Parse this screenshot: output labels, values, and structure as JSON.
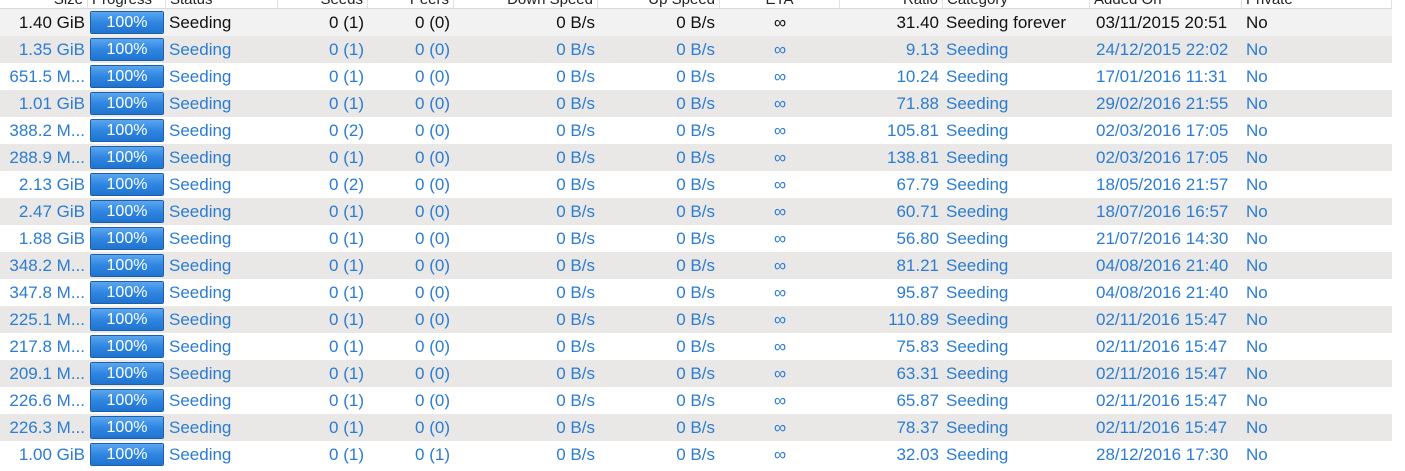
{
  "columns": {
    "size": "Size",
    "progress": "Progress",
    "status": "Status",
    "seeds": "Seeds",
    "peers": "Peers",
    "down_speed": "Down Speed",
    "up_speed": "Up Speed",
    "eta": "ETA",
    "ratio": "Ratio",
    "category": "Category",
    "added_on": "Added On",
    "private": "Private"
  },
  "colors": {
    "link_blue": "#2b7cd3",
    "selected_text": "#111111",
    "alt_row": "#eae8e6",
    "progress_blue": "#2f86e0"
  },
  "rows": [
    {
      "size": "1.40 GiB",
      "progress_label": "100%",
      "progress": 1.0,
      "status": "Seeding",
      "seeds": "0 (1)",
      "peers": "0 (0)",
      "down_speed": "0 B/s",
      "up_speed": "0 B/s",
      "eta": "∞",
      "ratio": "31.40",
      "category": "Seeding forever",
      "added_on": "03/11/2015 20:51",
      "private": "No",
      "selected": true
    },
    {
      "size": "1.35 GiB",
      "progress_label": "100%",
      "progress": 1.0,
      "status": "Seeding",
      "seeds": "0 (1)",
      "peers": "0 (0)",
      "down_speed": "0 B/s",
      "up_speed": "0 B/s",
      "eta": "∞",
      "ratio": "9.13",
      "category": "Seeding",
      "added_on": "24/12/2015 22:02",
      "private": "No"
    },
    {
      "size": "651.5 M...",
      "progress_label": "100%",
      "progress": 1.0,
      "status": "Seeding",
      "seeds": "0 (1)",
      "peers": "0 (0)",
      "down_speed": "0 B/s",
      "up_speed": "0 B/s",
      "eta": "∞",
      "ratio": "10.24",
      "category": "Seeding",
      "added_on": "17/01/2016 11:31",
      "private": "No"
    },
    {
      "size": "1.01 GiB",
      "progress_label": "100%",
      "progress": 1.0,
      "status": "Seeding",
      "seeds": "0 (1)",
      "peers": "0 (0)",
      "down_speed": "0 B/s",
      "up_speed": "0 B/s",
      "eta": "∞",
      "ratio": "71.88",
      "category": "Seeding",
      "added_on": "29/02/2016 21:55",
      "private": "No"
    },
    {
      "size": "388.2 M...",
      "progress_label": "100%",
      "progress": 1.0,
      "status": "Seeding",
      "seeds": "0 (2)",
      "peers": "0 (0)",
      "down_speed": "0 B/s",
      "up_speed": "0 B/s",
      "eta": "∞",
      "ratio": "105.81",
      "category": "Seeding",
      "added_on": "02/03/2016 17:05",
      "private": "No"
    },
    {
      "size": "288.9 M...",
      "progress_label": "100%",
      "progress": 1.0,
      "status": "Seeding",
      "seeds": "0 (1)",
      "peers": "0 (0)",
      "down_speed": "0 B/s",
      "up_speed": "0 B/s",
      "eta": "∞",
      "ratio": "138.81",
      "category": "Seeding",
      "added_on": "02/03/2016 17:05",
      "private": "No"
    },
    {
      "size": "2.13 GiB",
      "progress_label": "100%",
      "progress": 1.0,
      "status": "Seeding",
      "seeds": "0 (2)",
      "peers": "0 (0)",
      "down_speed": "0 B/s",
      "up_speed": "0 B/s",
      "eta": "∞",
      "ratio": "67.79",
      "category": "Seeding",
      "added_on": "18/05/2016 21:57",
      "private": "No"
    },
    {
      "size": "2.47 GiB",
      "progress_label": "100%",
      "progress": 1.0,
      "status": "Seeding",
      "seeds": "0 (1)",
      "peers": "0 (0)",
      "down_speed": "0 B/s",
      "up_speed": "0 B/s",
      "eta": "∞",
      "ratio": "60.71",
      "category": "Seeding",
      "added_on": "18/07/2016 16:57",
      "private": "No"
    },
    {
      "size": "1.88 GiB",
      "progress_label": "100%",
      "progress": 1.0,
      "status": "Seeding",
      "seeds": "0 (1)",
      "peers": "0 (0)",
      "down_speed": "0 B/s",
      "up_speed": "0 B/s",
      "eta": "∞",
      "ratio": "56.80",
      "category": "Seeding",
      "added_on": "21/07/2016 14:30",
      "private": "No"
    },
    {
      "size": "348.2 M...",
      "progress_label": "100%",
      "progress": 1.0,
      "status": "Seeding",
      "seeds": "0 (1)",
      "peers": "0 (0)",
      "down_speed": "0 B/s",
      "up_speed": "0 B/s",
      "eta": "∞",
      "ratio": "81.21",
      "category": "Seeding",
      "added_on": "04/08/2016 21:40",
      "private": "No"
    },
    {
      "size": "347.8 M...",
      "progress_label": "100%",
      "progress": 1.0,
      "status": "Seeding",
      "seeds": "0 (1)",
      "peers": "0 (0)",
      "down_speed": "0 B/s",
      "up_speed": "0 B/s",
      "eta": "∞",
      "ratio": "95.87",
      "category": "Seeding",
      "added_on": "04/08/2016 21:40",
      "private": "No"
    },
    {
      "size": "225.1 M...",
      "progress_label": "100%",
      "progress": 1.0,
      "status": "Seeding",
      "seeds": "0 (1)",
      "peers": "0 (0)",
      "down_speed": "0 B/s",
      "up_speed": "0 B/s",
      "eta": "∞",
      "ratio": "110.89",
      "category": "Seeding",
      "added_on": "02/11/2016 15:47",
      "private": "No"
    },
    {
      "size": "217.8 M...",
      "progress_label": "100%",
      "progress": 1.0,
      "status": "Seeding",
      "seeds": "0 (1)",
      "peers": "0 (0)",
      "down_speed": "0 B/s",
      "up_speed": "0 B/s",
      "eta": "∞",
      "ratio": "75.83",
      "category": "Seeding",
      "added_on": "02/11/2016 15:47",
      "private": "No"
    },
    {
      "size": "209.1 M...",
      "progress_label": "100%",
      "progress": 1.0,
      "status": "Seeding",
      "seeds": "0 (1)",
      "peers": "0 (0)",
      "down_speed": "0 B/s",
      "up_speed": "0 B/s",
      "eta": "∞",
      "ratio": "63.31",
      "category": "Seeding",
      "added_on": "02/11/2016 15:47",
      "private": "No"
    },
    {
      "size": "226.6 M...",
      "progress_label": "100%",
      "progress": 1.0,
      "status": "Seeding",
      "seeds": "0 (1)",
      "peers": "0 (0)",
      "down_speed": "0 B/s",
      "up_speed": "0 B/s",
      "eta": "∞",
      "ratio": "65.87",
      "category": "Seeding",
      "added_on": "02/11/2016 15:47",
      "private": "No"
    },
    {
      "size": "226.3 M...",
      "progress_label": "100%",
      "progress": 1.0,
      "status": "Seeding",
      "seeds": "0 (1)",
      "peers": "0 (0)",
      "down_speed": "0 B/s",
      "up_speed": "0 B/s",
      "eta": "∞",
      "ratio": "78.37",
      "category": "Seeding",
      "added_on": "02/11/2016 15:47",
      "private": "No"
    },
    {
      "size": "1.00 GiB",
      "progress_label": "100%",
      "progress": 1.0,
      "status": "Seeding",
      "seeds": "0 (1)",
      "peers": "0 (1)",
      "down_speed": "0 B/s",
      "up_speed": "0 B/s",
      "eta": "∞",
      "ratio": "32.03",
      "category": "Seeding",
      "added_on": "28/12/2016 17:30",
      "private": "No"
    }
  ]
}
